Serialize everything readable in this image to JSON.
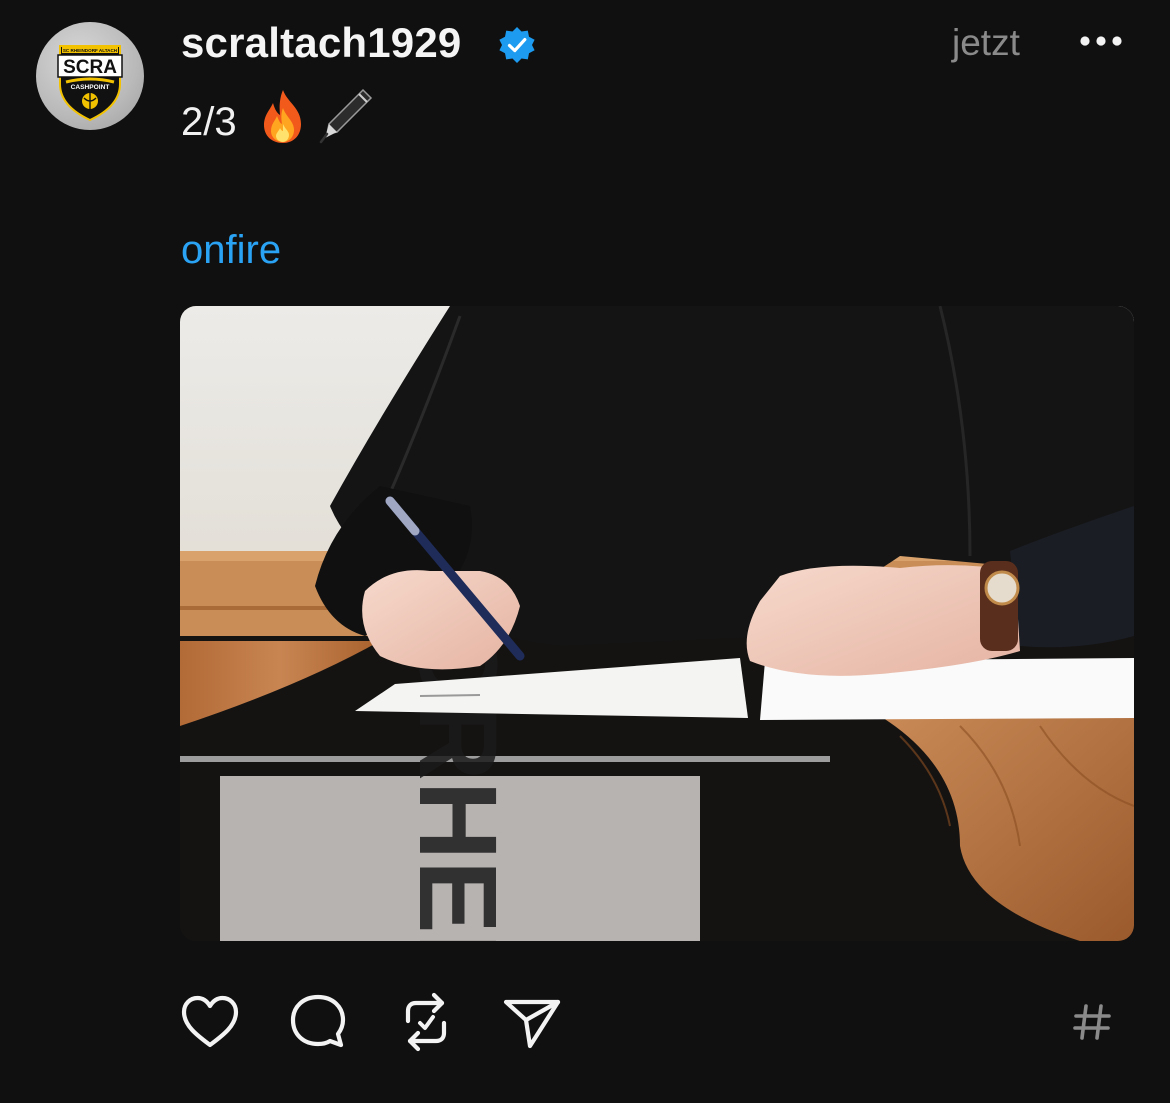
{
  "post": {
    "username": "scraltach1929",
    "verified": true,
    "timestamp": "jetzt",
    "caption_text": "2/3",
    "caption_emojis": [
      "fire-emoji",
      "pen-emoji"
    ],
    "hashtag": "onfire"
  },
  "avatar": {
    "logo_top_text": "SC RHEINDORF ALTACH",
    "logo_main": "SCRA",
    "logo_sponsor": "CASHPOINT"
  },
  "photo": {
    "desk_reflection_text": "SCRHEIN"
  },
  "icons": {
    "more": "more-horizontal-icon",
    "like": "heart-icon",
    "reply": "comment-bubble-icon",
    "repost": "repost-icon",
    "share": "send-icon",
    "topic": "hash-icon"
  },
  "colors": {
    "background": "#101010",
    "link": "#2aa3f5",
    "verified": "#1d9bf0",
    "muted": "#8a8a8a"
  }
}
